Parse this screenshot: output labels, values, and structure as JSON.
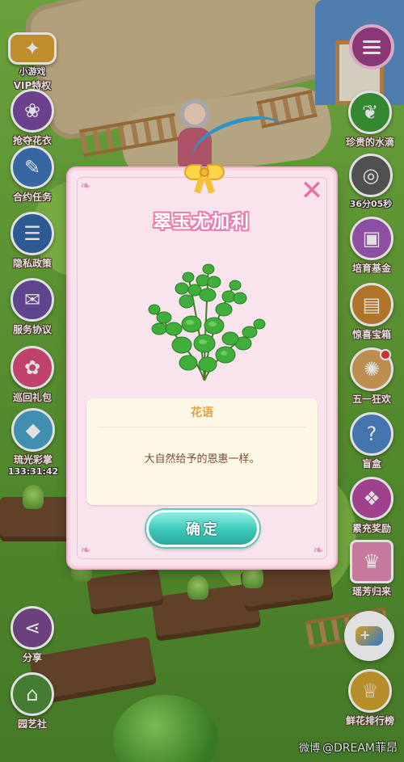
{
  "left_sidebar": [
    {
      "label": "VIP特权",
      "badge": "小游戏",
      "icon": "vip-crown-icon",
      "color": "#d9a234"
    },
    {
      "label": "抢夺花衣",
      "icon": "dress-icon",
      "color": "#7a4aa1"
    },
    {
      "label": "合约任务",
      "icon": "quill-icon",
      "color": "#3e76b9"
    },
    {
      "label": "隐私政策",
      "icon": "privacy-doc-icon",
      "color": "#3567a6"
    },
    {
      "label": "服务协议",
      "icon": "agreement-icon",
      "color": "#6d4fa2"
    },
    {
      "label": "巡回礼包",
      "icon": "gift-icon",
      "color": "#d94c7a"
    },
    {
      "label": "琉光彩掌",
      "sub": "133:31:42",
      "icon": "gem-icon",
      "color": "#4aa3c9"
    },
    {
      "label": "分享",
      "icon": "share-icon",
      "color": "#7a4a8f"
    },
    {
      "label": "园艺社",
      "icon": "garden-house-icon",
      "color": "#4e8f3a"
    }
  ],
  "right_sidebar": [
    {
      "label": "珍贵的水滴",
      "icon": "leaf-drop-icon",
      "color": "#3d9a3a"
    },
    {
      "label": "36分05秒",
      "icon": "film-reel-icon",
      "color": "#5c5c5c"
    },
    {
      "label": "培育基金",
      "icon": "fund-box-icon",
      "color": "#a05ab9"
    },
    {
      "label": "惊喜宝箱",
      "icon": "treasure-chest-icon",
      "color": "#c8842f"
    },
    {
      "label": "五一狂欢",
      "icon": "carnival-icon",
      "color": "#d6a15a",
      "has_dot": true
    },
    {
      "label": "盲盒",
      "icon": "blind-box-icon",
      "color": "#4f86c7"
    },
    {
      "label": "累充奖励",
      "icon": "reward-bag-icon",
      "color": "#b54aa0"
    },
    {
      "label": "瑶芳归来",
      "icon": "princess-icon",
      "color": "#e38ab3"
    },
    {
      "label": "鲜花排行榜",
      "icon": "trophy-icon",
      "color": "#d0a12f"
    }
  ],
  "dialog": {
    "title": "翠玉尤加利",
    "close_icon": "close-x-icon",
    "flower_language_header": "花语",
    "flower_language_text": "大自然给予的恩惠一样。",
    "confirm_label": "确定"
  },
  "watermark": {
    "platform": "微博",
    "text": "@DREAM菲昂"
  },
  "colors": {
    "dialog_bg": "#f9e4ee",
    "title_outline": "#e97fb0",
    "confirm_btn": "#3cc7b8",
    "header_text": "#e3a043"
  }
}
